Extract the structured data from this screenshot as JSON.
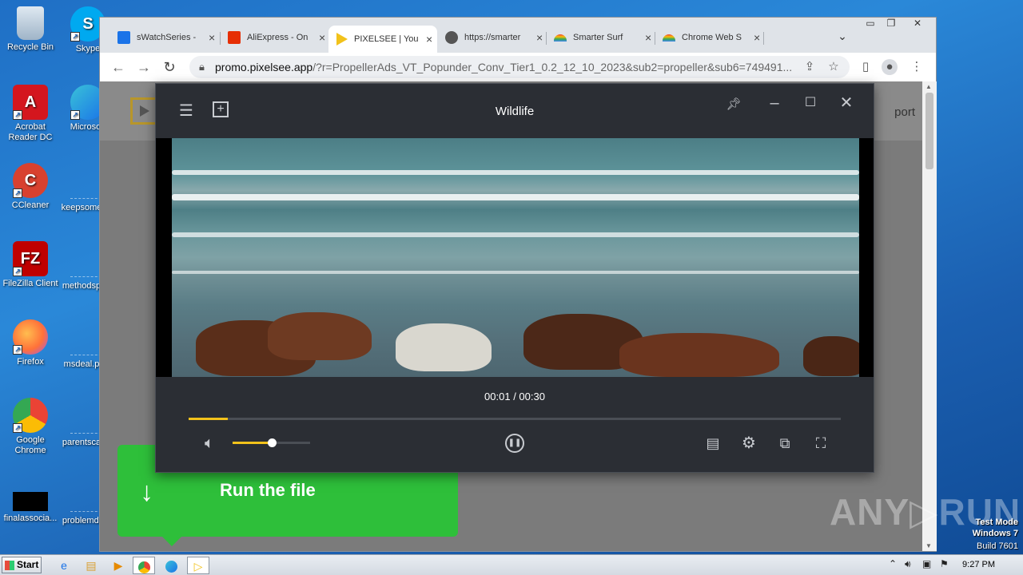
{
  "desktop": {
    "icons": [
      {
        "label": "Recycle Bin",
        "icon": "recycle-bin-icon"
      },
      {
        "label": "Skype",
        "icon": "skype-icon"
      },
      {
        "label": "Acrobat Reader DC",
        "icon": "acrobat-icon"
      },
      {
        "label": "Microsoft",
        "icon": "edge-icon"
      },
      {
        "label": "CCleaner",
        "icon": "ccleaner-icon"
      },
      {
        "label": "keepsome",
        "icon": "file-icon"
      },
      {
        "label": "FileZilla Client",
        "icon": "filezilla-icon"
      },
      {
        "label": "methodsp",
        "icon": "file-icon"
      },
      {
        "label": "Firefox",
        "icon": "firefox-icon"
      },
      {
        "label": "msdeal.p",
        "icon": "file-icon"
      },
      {
        "label": "Google Chrome",
        "icon": "chrome-icon"
      },
      {
        "label": "parentsca",
        "icon": "file-icon"
      },
      {
        "label": "finalassocia...",
        "icon": "file-icon"
      },
      {
        "label": "problemdi",
        "icon": "file-icon"
      }
    ]
  },
  "browser": {
    "tabs": [
      {
        "title": "sWatchSeries -",
        "close": "×",
        "color": "#1a73e8"
      },
      {
        "title": "AliExpress - On",
        "close": "×",
        "color": "#e62e04"
      },
      {
        "title": "PIXELSEE | You",
        "close": "×",
        "color": "#f2c21b"
      },
      {
        "title": "https://smarter",
        "close": "×",
        "color": "#555555"
      },
      {
        "title": "Smarter Surf",
        "close": "×",
        "color": "#ea4335"
      },
      {
        "title": "Chrome Web S",
        "close": "×",
        "color": "#ea4335"
      }
    ],
    "new_tab": "+",
    "tab_search": "⌄",
    "window_controls": {
      "minimize": "▭",
      "restore": "❐",
      "close": "✕"
    },
    "url_host": "promo.pixelsee.app",
    "url_path": "/?r=PropellerAds_VT_Popunder_Conv_Tier1_0.2_12_10_2023&sub2=propeller&sub6=749491...",
    "page": {
      "support_link": "port"
    }
  },
  "player": {
    "title": "Wildlife",
    "time_current": "00:01",
    "time_total": "00:30",
    "time_sep": " / ",
    "progress": 0.06,
    "volume": 0.5
  },
  "banner": {
    "label": "Run the file",
    "arrow": "↓"
  },
  "watermark": "ANY▷RUN",
  "sysinfo": {
    "line1": "Test Mode",
    "line2": "Windows 7",
    "line3": "Build 7601"
  },
  "taskbar": {
    "start": "Start",
    "clock": "9:27 PM"
  }
}
